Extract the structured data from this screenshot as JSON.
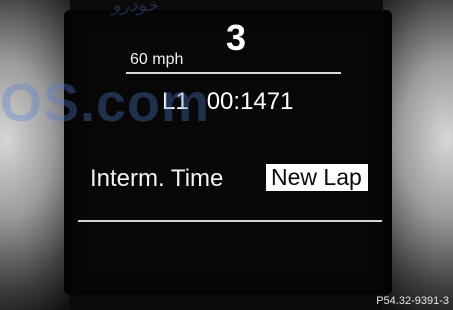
{
  "dashboard": {
    "speed": "60 mph",
    "gear": "3",
    "lap_label": "L1",
    "lap_time": "00:1471"
  },
  "menu": {
    "interm_time_label": "Interm. Time",
    "new_lap_label": "New Lap"
  },
  "watermark": {
    "large": "OS.com",
    "small": "خودرو"
  },
  "figure_ref": "P54.32-9391-3"
}
